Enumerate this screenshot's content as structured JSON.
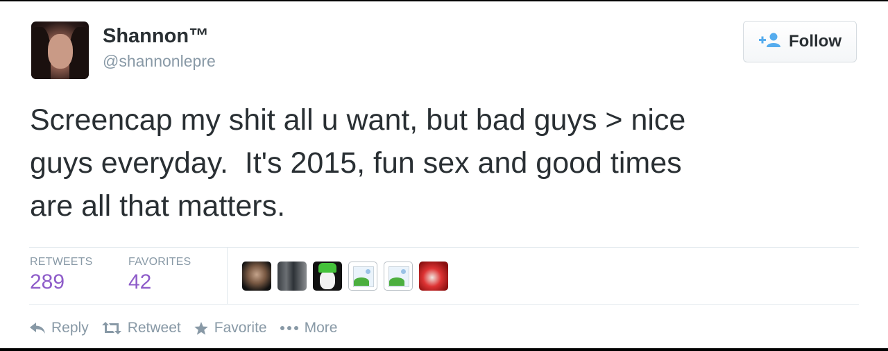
{
  "user": {
    "name": "Shannon™",
    "handle": "@shannonlepre"
  },
  "follow_button": {
    "label": "Follow",
    "icon": "add-person-icon",
    "accent": "#55acee"
  },
  "tweet": {
    "text": "Screencap my shit all u want, but bad guys > nice\nguys everyday.  It's 2015, fun sex and good times\nare all that matters."
  },
  "stats": {
    "retweets_label": "RETWEETS",
    "retweets_count": "289",
    "favorites_label": "FAVORITES",
    "favorites_count": "42",
    "count_color": "#8e5cc9"
  },
  "favoriters": [
    {
      "icon": "user-avatar"
    },
    {
      "icon": "user-avatar"
    },
    {
      "icon": "user-avatar"
    },
    {
      "icon": "broken-image-icon"
    },
    {
      "icon": "broken-image-icon"
    },
    {
      "icon": "user-avatar"
    }
  ],
  "actions": {
    "reply": "Reply",
    "retweet": "Retweet",
    "favorite": "Favorite",
    "more": "More"
  }
}
